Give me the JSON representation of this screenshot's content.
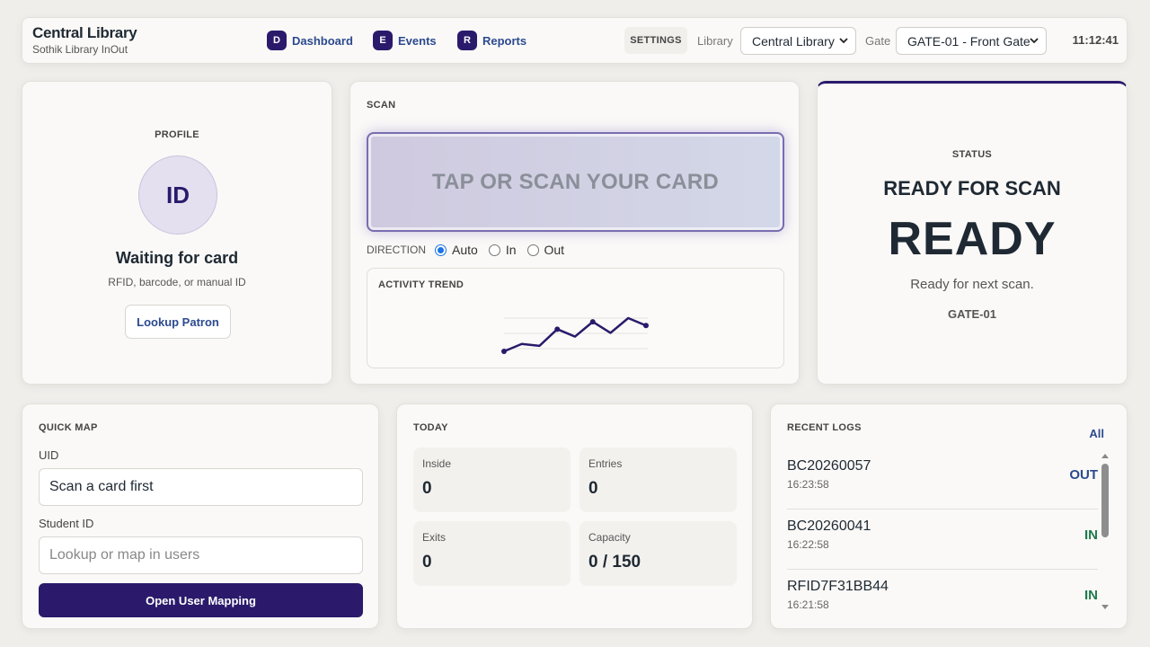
{
  "topbar": {
    "library_name": "Central Library",
    "app_name": "Sothik Library InOut",
    "nav": [
      {
        "badge": "D",
        "label": "Dashboard"
      },
      {
        "badge": "E",
        "label": "Events"
      },
      {
        "badge": "R",
        "label": "Reports"
      }
    ],
    "settings_label": "SETTINGS",
    "library_label": "Library",
    "library_value": "Central Library",
    "gate_label": "Gate",
    "gate_value": "GATE-01 - Front Gate",
    "clock": "11:12:41"
  },
  "profile": {
    "section_label": "PROFILE",
    "avatar_text": "ID",
    "name": "Waiting for card",
    "hint": "RFID, barcode, or manual ID",
    "lookup_label": "Lookup Patron"
  },
  "scan": {
    "section_label": "SCAN",
    "prompt": "TAP OR SCAN YOUR CARD",
    "direction_label": "DIRECTION",
    "direction_options": [
      "Auto",
      "In",
      "Out"
    ],
    "direction_selected": "Auto",
    "trend_label": "ACTIVITY TREND",
    "trend_values": [
      0,
      4,
      3,
      12,
      8,
      16,
      10,
      18,
      14
    ]
  },
  "status": {
    "section_label": "STATUS",
    "headline": "READY FOR SCAN",
    "big": "READY",
    "message": "Ready for next scan.",
    "gate": "GATE-01"
  },
  "quick_map": {
    "section_label": "QUICK MAP",
    "uid_label": "UID",
    "uid_value": "Scan a card first",
    "student_label": "Student ID",
    "student_placeholder": "Lookup or map in users",
    "button_label": "Open User Mapping"
  },
  "today": {
    "section_label": "TODAY",
    "stats": [
      {
        "label": "Inside",
        "value": "0"
      },
      {
        "label": "Entries",
        "value": "0"
      },
      {
        "label": "Exits",
        "value": "0"
      },
      {
        "label": "Capacity",
        "value": "0 / 150"
      }
    ]
  },
  "logs": {
    "section_label": "RECENT LOGS",
    "all_label": "All",
    "items": [
      {
        "id": "BC20260057",
        "time": "16:23:58",
        "direction": "OUT"
      },
      {
        "id": "BC20260041",
        "time": "16:22:58",
        "direction": "IN"
      },
      {
        "id": "RFID7F31BB44",
        "time": "16:21:58",
        "direction": "IN"
      }
    ]
  },
  "colors": {
    "accent": "#2b1a6b",
    "link": "#2c4a8f",
    "in": "#1f7a4d",
    "out": "#2c4a8f"
  }
}
